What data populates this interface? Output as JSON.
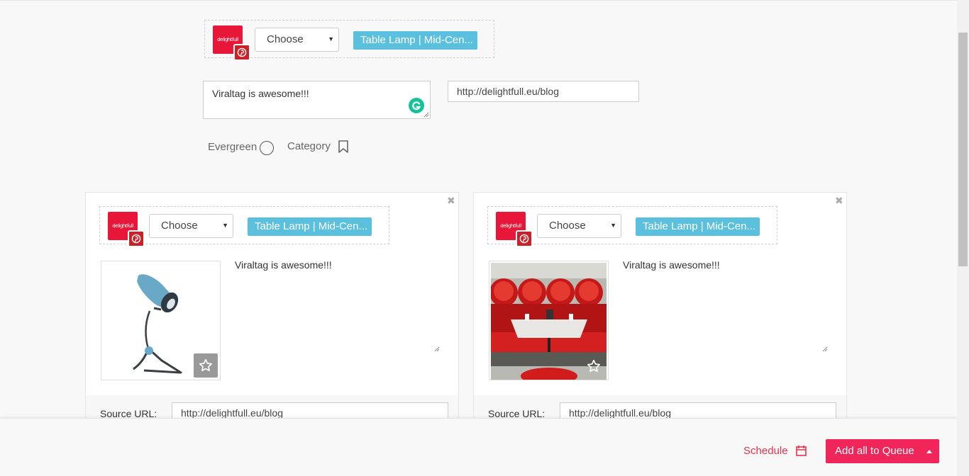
{
  "top_group": {
    "account_brand": "delightfull",
    "select_value": "Choose",
    "board_tag": "Table Lamp | Mid-Cen..."
  },
  "composer": {
    "message": "Viraltag is awesome!!!",
    "url": "http://delightfull.eu/blog",
    "evergreen_label": "Evergreen",
    "category_label": "Category"
  },
  "cards": [
    {
      "account_brand": "delightfull",
      "select_value": "Choose",
      "board_tag": "Table Lamp | Mid-Cen...",
      "caption": "Viraltag is awesome!!!",
      "source_label": "Source URL:",
      "source_url": "http://delightfull.eu/blog",
      "image": "blue-desk-lamp"
    },
    {
      "account_brand": "delightfull",
      "select_value": "Choose",
      "board_tag": "Table Lamp | Mid-Cen...",
      "caption": "Viraltag is awesome!!!",
      "source_label": "Source URL:",
      "source_url": "http://delightfull.eu/blog",
      "image": "red-restaurant-booth"
    }
  ],
  "footer": {
    "schedule_label": "Schedule",
    "queue_label": "Add all to Queue"
  },
  "colors": {
    "brand_red": "#e8173a",
    "pinterest_red": "#cb2027",
    "tag_blue": "#5bc0de",
    "queue_pink": "#f0265a",
    "grammarly_green": "#15c39a"
  },
  "icons": [
    "pinterest-icon",
    "grammarly-icon",
    "radio-circle-icon",
    "bookmark-icon",
    "close-icon",
    "star-icon",
    "calendar-icon",
    "caret-up-icon",
    "chevron-down-icon"
  ]
}
